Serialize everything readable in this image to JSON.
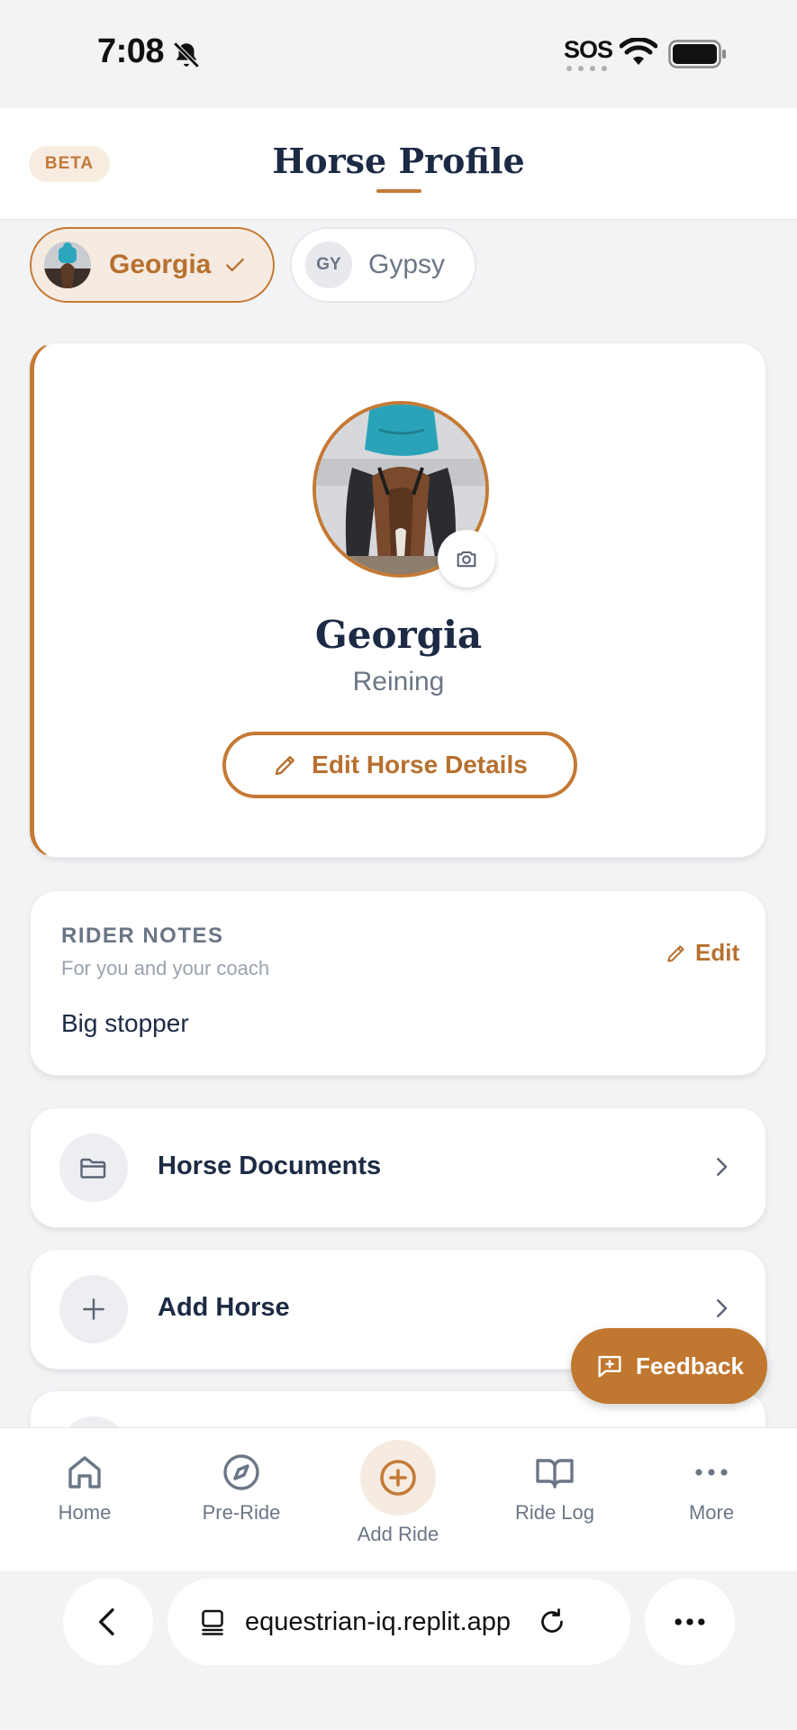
{
  "status_bar": {
    "time": "7:08",
    "carrier": "SOS"
  },
  "header": {
    "badge": "BETA",
    "title": "Horse Profile"
  },
  "horse_chips": [
    {
      "label": "Georgia",
      "selected": true
    },
    {
      "label": "Gypsy",
      "initials": "GY",
      "selected": false
    }
  ],
  "profile": {
    "name": "Georgia",
    "discipline": "Reining",
    "edit_label": "Edit Horse Details"
  },
  "rider_notes": {
    "title": "RIDER NOTES",
    "subtitle": "For you and your coach",
    "edit_label": "Edit",
    "text": "Big stopper"
  },
  "rows": [
    {
      "label": "Horse Documents",
      "icon": "folder-icon"
    },
    {
      "label": "Add Horse",
      "icon": "plus-icon"
    }
  ],
  "feedback_label": "Feedback",
  "bottom_nav": [
    {
      "label": "Home",
      "icon": "home-icon"
    },
    {
      "label": "Pre-Ride",
      "icon": "compass-icon"
    },
    {
      "label": "Add Ride",
      "icon": "add-circle-icon"
    },
    {
      "label": "Ride Log",
      "icon": "book-icon"
    },
    {
      "label": "More",
      "icon": "more-icon"
    }
  ],
  "browser": {
    "url": "equestrian-iq.replit.app"
  },
  "colors": {
    "accent": "#c47a35",
    "navy": "#1c2a44",
    "muted": "#6b7686",
    "background": "#f2f3f5"
  }
}
